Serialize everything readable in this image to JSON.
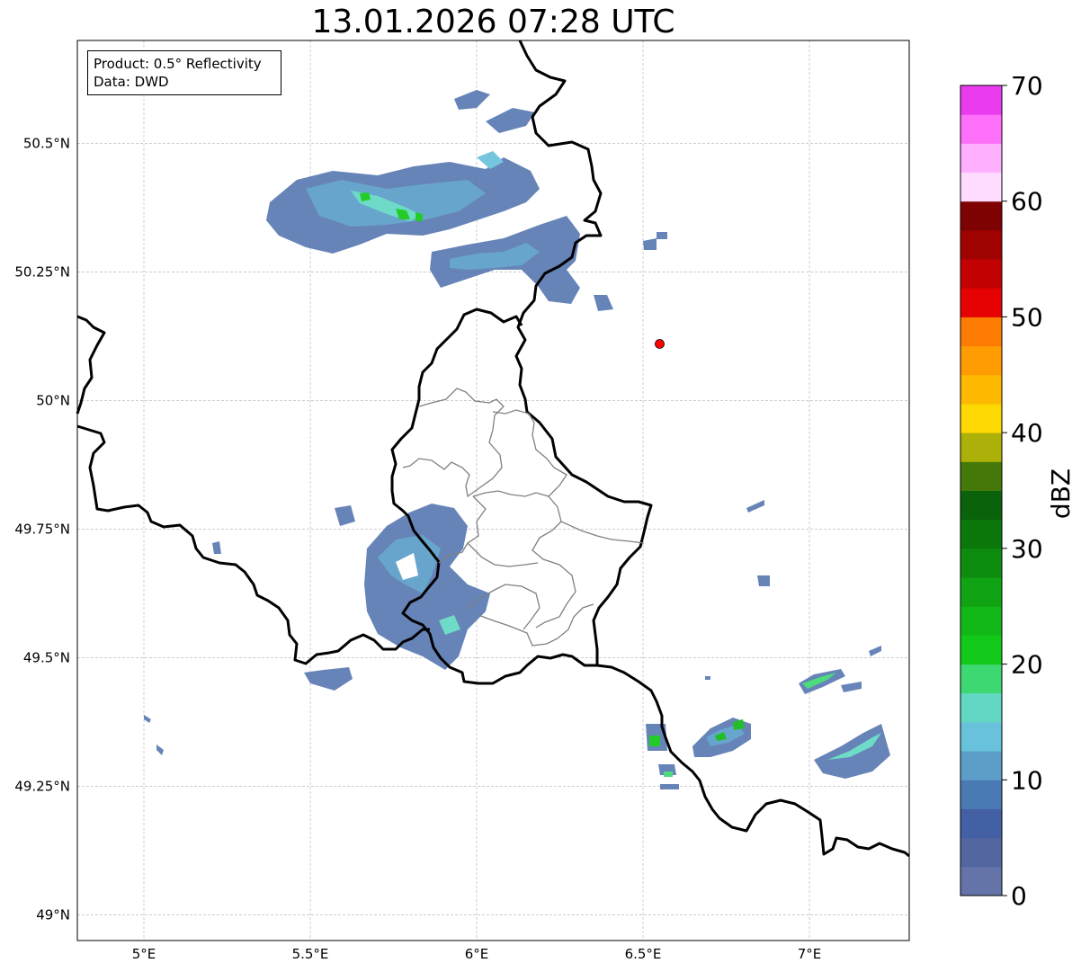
{
  "title": "13.01.2026 07:28 UTC",
  "info_box": {
    "product": "Product: 0.5° Reflectivity",
    "data": "Data: DWD"
  },
  "axes": {
    "lon_range": [
      4.8,
      7.3
    ],
    "lat_range": [
      48.95,
      50.7
    ],
    "lon_ticks": [
      {
        "value": 5.0,
        "label": "5°E"
      },
      {
        "value": 5.5,
        "label": "5.5°E"
      },
      {
        "value": 6.0,
        "label": "6°E"
      },
      {
        "value": 6.5,
        "label": "6.5°E"
      },
      {
        "value": 7.0,
        "label": "7°E"
      }
    ],
    "lat_ticks": [
      {
        "value": 49.0,
        "label": "49°N"
      },
      {
        "value": 49.25,
        "label": "49.25°N"
      },
      {
        "value": 49.5,
        "label": "49.5°N"
      },
      {
        "value": 49.75,
        "label": "49.75°N"
      },
      {
        "value": 50.0,
        "label": "50°N"
      },
      {
        "value": 50.25,
        "label": "50.25°N"
      },
      {
        "value": 50.5,
        "label": "50.5°N"
      }
    ],
    "grid": true
  },
  "station_marker": {
    "lon": 6.55,
    "lat": 50.11,
    "color": "#ff0000"
  },
  "colorbar": {
    "label": "dBZ",
    "min": 0,
    "max": 70,
    "ticks": [
      0,
      10,
      20,
      30,
      40,
      50,
      60,
      70
    ],
    "colors": [
      "#6474a8",
      "#5466a0",
      "#4460a4",
      "#4a7ab4",
      "#5c9ec8",
      "#68c2dc",
      "#62d8c4",
      "#3ed872",
      "#12c818",
      "#12b818",
      "#10a414",
      "#0e8c10",
      "#0c780c",
      "#0a620a",
      "#447808",
      "#acb008",
      "#fed802",
      "#fdb800",
      "#fe9c02",
      "#fe7c02",
      "#e60202",
      "#c20202",
      "#a00202",
      "#7e0202",
      "#fedcff",
      "#feb0ff",
      "#fe70fa",
      "#ea3cee"
    ]
  },
  "border_colors": {
    "national": "#000000",
    "cantonal": "#808080"
  }
}
